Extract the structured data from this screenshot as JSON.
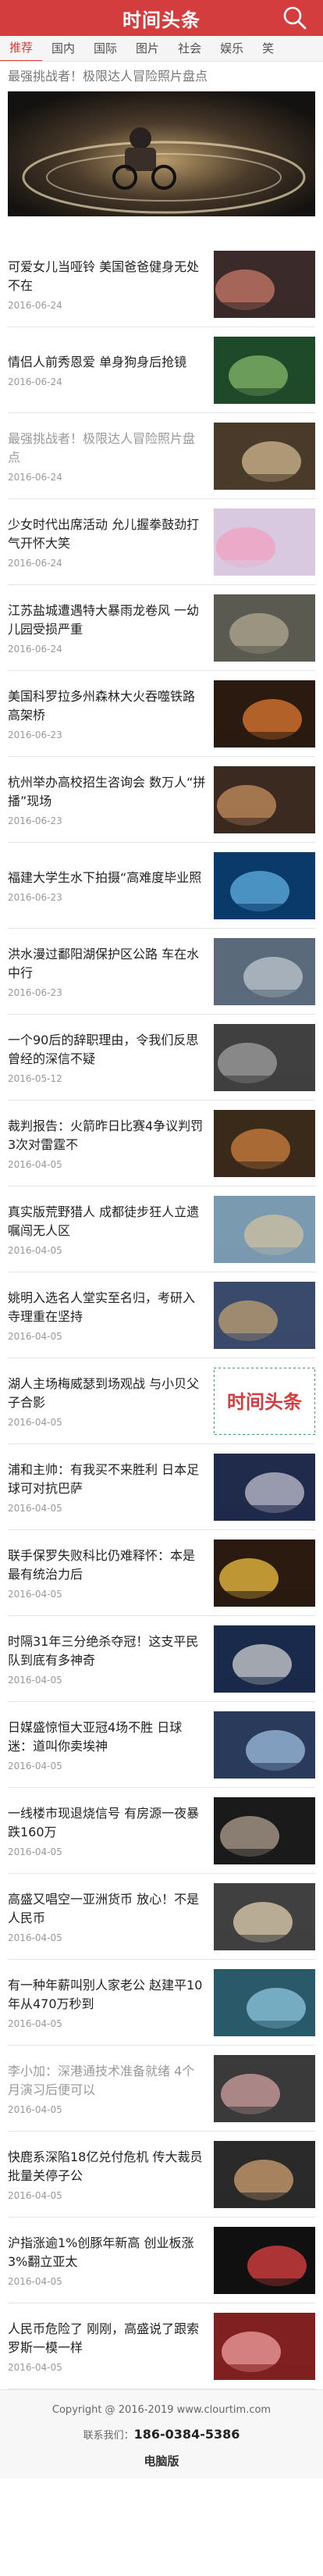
{
  "header": {
    "logo": "时间头条",
    "search_icon": "search-icon"
  },
  "tabs": [
    {
      "label": "推荐",
      "active": true
    },
    {
      "label": "国内"
    },
    {
      "label": "国际"
    },
    {
      "label": "图片"
    },
    {
      "label": "社会"
    },
    {
      "label": "娱乐"
    },
    {
      "label": "笑"
    }
  ],
  "featured": {
    "title": "最强挑战者！极限达人冒险照片盘点"
  },
  "items": [
    {
      "title": "可爱女儿当哑铃 美国爸爸健身无处不在",
      "date": "2016-06-24"
    },
    {
      "title": "情侣人前秀恩爱 单身狗身后抢镜",
      "date": "2016-06-24"
    },
    {
      "title": "最强挑战者！极限达人冒险照片盘点",
      "date": "2016-06-24",
      "read": true
    },
    {
      "title": "少女时代出席活动 允儿握拳鼓劲打气开怀大笑",
      "date": "2016-06-24"
    },
    {
      "title": "江苏盐城遭遇特大暴雨龙卷风 一幼儿园受损严重",
      "date": "2016-06-24"
    },
    {
      "title": "美国科罗拉多州森林大火吞噬铁路高架桥",
      "date": "2016-06-23"
    },
    {
      "title": "杭州举办高校招生咨询会 数万人“拼播”现场",
      "date": "2016-06-23"
    },
    {
      "title": "福建大学生水下拍摄“高难度毕业照",
      "date": "2016-06-23"
    },
    {
      "title": "洪水漫过鄱阳湖保护区公路 车在水中行",
      "date": "2016-06-23"
    },
    {
      "title": "一个90后的辞职理由，令我们反思曾经的深信不疑",
      "date": "2016-05-12"
    },
    {
      "title": "裁判报告：火箭昨日比赛4争议判罚 3次对雷霆不",
      "date": "2016-04-05"
    },
    {
      "title": "真实版荒野猎人 成都徒步狂人立遗嘱闯无人区",
      "date": "2016-04-05"
    },
    {
      "title": "姚明入选名人堂实至名归，考研入寺理重在坚持",
      "date": "2016-04-05"
    },
    {
      "title": "湖人主场梅威瑟到场观战 与小贝父子合影",
      "date": "2016-04-05"
    },
    {
      "title": "浦和主帅：有我买不来胜利 日本足球可对抗巴萨",
      "date": "2016-04-05"
    },
    {
      "title": "联手保罗失败科比仍难释怀：本是最有统治力后",
      "date": "2016-04-05"
    },
    {
      "title": "时隔31年三分绝杀夺冠！这支平民队到底有多神奇",
      "date": "2016-04-05"
    },
    {
      "title": "日媒盛惊恒大亚冠4场不胜 日球迷：道叫你卖埃神",
      "date": "2016-04-05"
    },
    {
      "title": "一线楼市现退烧信号 有房源一夜暴跌160万",
      "date": "2016-04-05"
    },
    {
      "title": "高盛又唱空一亚洲货币 放心！不是人民币",
      "date": "2016-04-05"
    },
    {
      "title": "有一种年薪叫别人家老公 赵建平10年从470万秒到",
      "date": "2016-04-05"
    },
    {
      "title": "李小加：深港通技术准备就绪 4个月演习后便可以",
      "date": "2016-04-05",
      "read": true
    },
    {
      "title": "快鹿系深陷18亿兑付危机 传大裁员批量关停子公",
      "date": "2016-04-05"
    },
    {
      "title": "沪指涨逾1%创豚年新高 创业板涨3%翻立亚太",
      "date": "2016-04-05"
    },
    {
      "title": "人民币危险了 刚刚，高盛说了跟索罗斯一模一样",
      "date": "2016-04-05"
    }
  ],
  "footer": {
    "copyright": "Copyright @ 2016-2019 www.clourtim.com",
    "contact_label": "联系我们：",
    "phone": "186-0384-5386",
    "pc_link": "电脑版"
  }
}
